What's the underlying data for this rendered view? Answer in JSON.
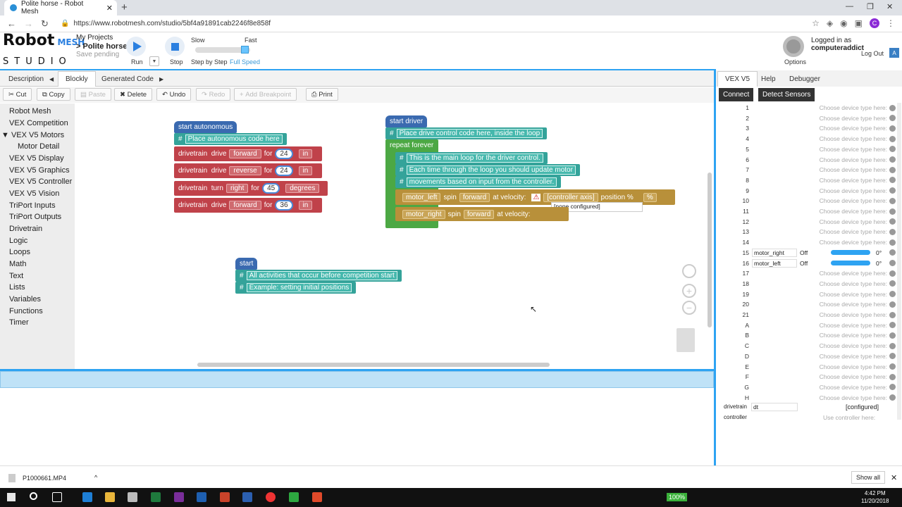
{
  "browser": {
    "tab_title": "Polite horse - Robot Mesh",
    "url": "https://www.robotmesh.com/studio/5bf4a91891cab2246f8e858f",
    "avatar": "C"
  },
  "header": {
    "logo_top": "Robot",
    "logo_mid": "MESH",
    "logo_bottom": "STUDIO",
    "my_projects": "My Projects",
    "project_name": "> Polite horse",
    "save_status": "Save pending",
    "run": "Run",
    "stop": "Stop",
    "slow": "Slow",
    "fast": "Fast",
    "step": "Step by Step",
    "full_speed": "Full Speed",
    "options": "Options",
    "logged_in_prefix": "Logged in as ",
    "username": "computeraddict",
    "logout": "Log Out"
  },
  "tabs": {
    "description": "Description",
    "blockly": "Blockly",
    "generated": "Generated Code"
  },
  "toolbar": {
    "cut": "Cut",
    "copy": "Copy",
    "paste": "Paste",
    "delete": "Delete",
    "undo": "Undo",
    "redo": "Redo",
    "breakpoint": "Add Breakpoint",
    "print": "Print"
  },
  "categories": [
    "Robot Mesh",
    "VEX Competition",
    "▼ VEX V5 Motors",
    "Motor Detail",
    "VEX V5 Display",
    "VEX V5 Graphics",
    "VEX V5 Controller",
    "VEX V5 Vision",
    "TriPort Inputs",
    "TriPort Outputs",
    "Drivetrain",
    "Logic",
    "Loops",
    "Math",
    "Text",
    "Lists",
    "Variables",
    "Functions",
    "Timer"
  ],
  "blocks": {
    "auto_hat": "start autonomous",
    "auto_cmt": "Place autonomous code here",
    "drivetrain": "drivetrain",
    "drive": "drive",
    "turn": "turn",
    "for": "for",
    "forward": "forward",
    "reverse": "reverse",
    "right": "right",
    "in": "in",
    "degrees": "degrees",
    "n24": "24",
    "n24b": "24",
    "n45": "45",
    "n36": "36",
    "driver_hat": "start driver",
    "driver_cmt": "Place drive control code here, inside the loop",
    "repeat": "repeat forever",
    "c1": "This is the main loop for the driver control.",
    "c2": "Each time through the loop you should update motor",
    "c3": "movements based on input from the controller.",
    "motor_left": "motor_left",
    "motor_right": "motor_right",
    "spin": "spin",
    "at_velocity": "at velocity:",
    "ctrl_axis": "[controller axis]",
    "position": "position",
    "pct": "%",
    "pct2": "%",
    "none_cfg": "[none configured]",
    "start_hat": "start",
    "s1": "All activities that occur before competition start",
    "s2": "Example: setting initial positions"
  },
  "right": {
    "tab_vex": "VEX V5",
    "tab_help": "Help",
    "tab_debugger": "Debugger",
    "connect": "Connect",
    "detect": "Detect Sensors",
    "ports": [
      {
        "n": "1",
        "v": "Choose device type here:"
      },
      {
        "n": "2",
        "v": "Choose device type here:"
      },
      {
        "n": "3",
        "v": "Choose device type here:"
      },
      {
        "n": "4",
        "v": "Choose device type here:"
      },
      {
        "n": "5",
        "v": "Choose device type here:"
      },
      {
        "n": "6",
        "v": "Choose device type here:"
      },
      {
        "n": "7",
        "v": "Choose device type here:"
      },
      {
        "n": "8",
        "v": "Choose device type here:"
      },
      {
        "n": "9",
        "v": "Choose device type here:"
      },
      {
        "n": "10",
        "v": "Choose device type here:"
      },
      {
        "n": "11",
        "v": "Choose device type here:"
      },
      {
        "n": "12",
        "v": "Choose device type here:"
      },
      {
        "n": "13",
        "v": "Choose device type here:"
      },
      {
        "n": "14",
        "v": "Choose device type here:"
      },
      {
        "n": "15",
        "name": "motor_right",
        "state": "Off",
        "deg": "0°"
      },
      {
        "n": "16",
        "name": "motor_left",
        "state": "Off",
        "deg": "0°"
      },
      {
        "n": "17",
        "v": "Choose device type here:"
      },
      {
        "n": "18",
        "v": "Choose device type here:"
      },
      {
        "n": "19",
        "v": "Choose device type here:"
      },
      {
        "n": "20",
        "v": "Choose device type here:"
      },
      {
        "n": "21",
        "v": "Choose device type here:"
      },
      {
        "n": "A",
        "v": "Choose device type here:"
      },
      {
        "n": "B",
        "v": "Choose device type here:"
      },
      {
        "n": "C",
        "v": "Choose device type here:"
      },
      {
        "n": "D",
        "v": "Choose device type here:"
      },
      {
        "n": "E",
        "v": "Choose device type here:"
      },
      {
        "n": "F",
        "v": "Choose device type here:"
      },
      {
        "n": "G",
        "v": "Choose device type here:"
      },
      {
        "n": "H",
        "v": "Choose device type here:"
      }
    ],
    "drivetrain_label": "drivetrain",
    "drivetrain_value": "dt",
    "drivetrain_state": "[configured]",
    "controller_label": "controller",
    "controller_value": "Use controller here:"
  },
  "downloads": {
    "file": "P1000661.MP4",
    "show_all": "Show all"
  },
  "taskbar": {
    "battery": "100%",
    "time": "4:42 PM",
    "date": "11/20/2018"
  }
}
